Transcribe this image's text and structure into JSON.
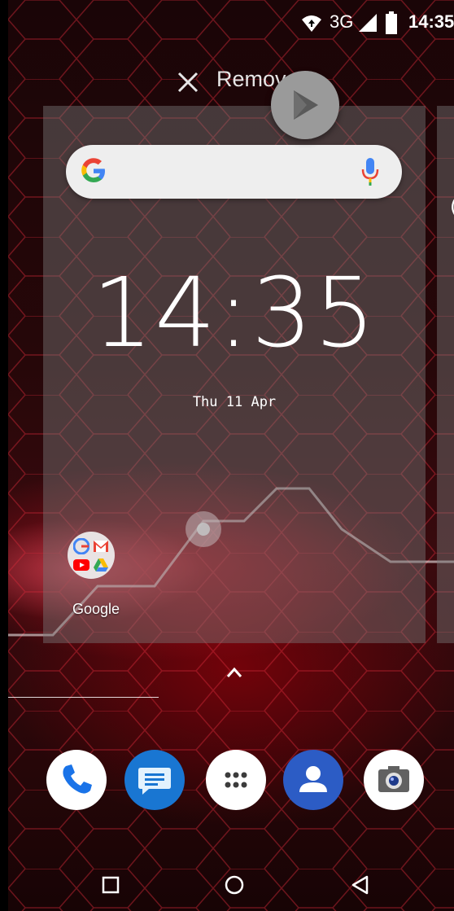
{
  "status_bar": {
    "network": "3G",
    "time": "14:35",
    "icons": [
      "wifi-icon",
      "signal-icon",
      "battery-icon"
    ]
  },
  "recents": {
    "remove_label": "Remove",
    "overlay_app_icon": "play-store-icon"
  },
  "home_card": {
    "search_icons": [
      "google-g-icon",
      "microphone-icon"
    ],
    "clock": "14:35",
    "date": "Thu 11 Apr",
    "folder": {
      "label": "Google",
      "apps": [
        "google-icon",
        "gmail-icon",
        "youtube-icon",
        "drive-icon"
      ]
    },
    "next_card_peek": "("
  },
  "dock": {
    "apps": [
      "phone-icon",
      "messages-icon",
      "app-drawer-icon",
      "contacts-icon",
      "camera-icon"
    ]
  },
  "nav_bar": {
    "buttons": [
      "recents-button",
      "home-button",
      "back-button"
    ]
  },
  "colors": {
    "accent_red": "#c8102e",
    "phone_blue": "#1a73e8",
    "messages_blue": "#1976d2",
    "contacts_blue": "#2c5cc5"
  }
}
